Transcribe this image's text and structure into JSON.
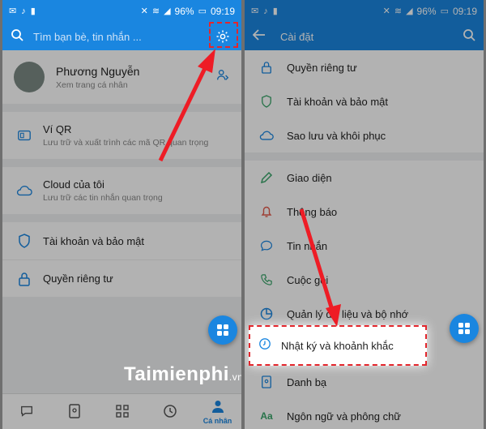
{
  "status_left": {
    "time": "09:19",
    "battery": "96%"
  },
  "status_right": {
    "time": "09:19",
    "battery": "96%"
  },
  "left": {
    "search_placeholder": "Tìm bạn bè, tin nhắn ...",
    "profile": {
      "name": "Phương Nguyễn",
      "subtitle": "Xem trang cá nhân"
    },
    "qr": {
      "title": "Ví QR",
      "subtitle": "Lưu trữ và xuất trình các mã QR quan trọng"
    },
    "cloud": {
      "title": "Cloud của tôi",
      "subtitle": "Lưu trữ các tin nhắn quan trọng"
    },
    "account": {
      "title": "Tài khoản và bảo mật"
    },
    "privacy": {
      "title": "Quyền riêng tư"
    },
    "nav": {
      "profile_label": "Cá nhân"
    }
  },
  "right": {
    "title": "Cài đặt",
    "items": [
      {
        "label": "Quyền riêng tư"
      },
      {
        "label": "Tài khoản và bảo mật"
      },
      {
        "label": "Sao lưu và khôi phục"
      },
      {
        "label": "Giao diện"
      },
      {
        "label": "Thông báo"
      },
      {
        "label": "Tin nhắn"
      },
      {
        "label": "Cuộc gọi"
      },
      {
        "label": "Quản lý dữ liệu và bộ nhớ"
      },
      {
        "label": "Nhật ký và khoảnh khắc"
      },
      {
        "label": "Danh bạ"
      },
      {
        "label": "Ngôn ngữ và phông chữ"
      }
    ]
  },
  "watermark": {
    "brand": "Taimienphi",
    "tld": ".vn"
  },
  "colors": {
    "primary": "#1a86e0",
    "highlight_border": "#e3262c",
    "arrow": "#ee1c25"
  }
}
